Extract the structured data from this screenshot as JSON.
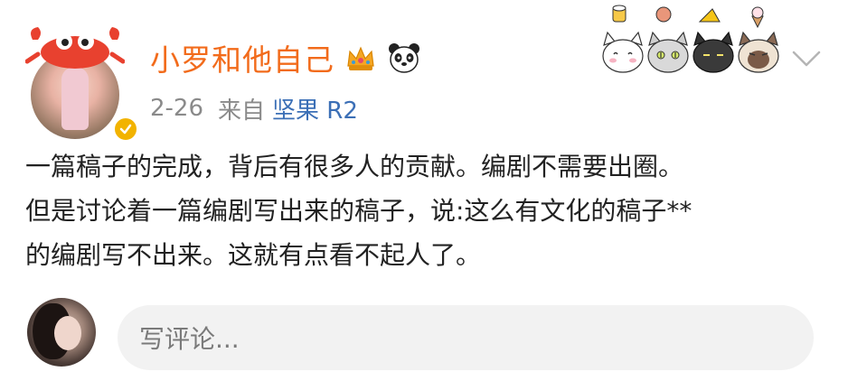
{
  "post": {
    "username": "小罗和他自己",
    "date": "2-26",
    "source_prefix": "来自",
    "source_name": "坚果 R2",
    "body_lines": [
      "一篇稿子的完成，背后有很多人的贡献。编剧不需要出圈。",
      "但是讨论着一篇编剧写出来的稿子，说:这么有文化的稿子**",
      "的编剧写不出来。这就有点看不起人了。"
    ]
  },
  "icons": {
    "verified": "verified-badge-icon",
    "crown": "crown-icon",
    "panda": "panda-icon",
    "stickers": "cat-stickers",
    "more": "chevron-down-icon"
  },
  "comment": {
    "placeholder": "写评论..."
  },
  "colors": {
    "username": "#f26b1b",
    "source": "#3b6fb6",
    "meta": "#8a8a8a",
    "verified": "#f2b300",
    "input_bg": "#f2f2f2"
  }
}
